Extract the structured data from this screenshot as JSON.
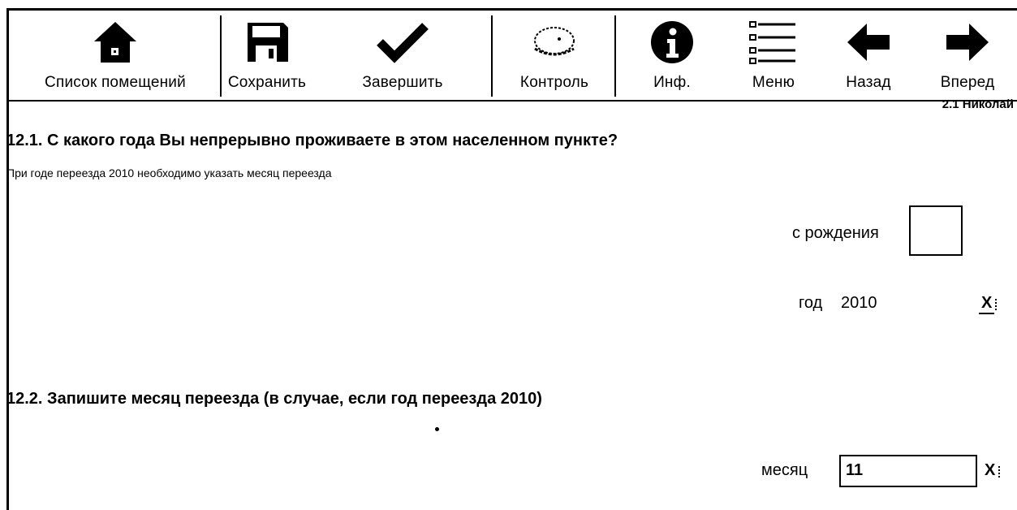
{
  "toolbar": {
    "items": [
      {
        "label": "Список помещений",
        "icon": "home-icon"
      },
      {
        "label": "Сохранить",
        "icon": "save-icon"
      },
      {
        "label": "Завершить",
        "icon": "checkmark-icon"
      },
      {
        "label": "Контроль",
        "icon": "control-icon"
      },
      {
        "label": "Инф.",
        "icon": "info-icon"
      },
      {
        "label": "Меню",
        "icon": "menu-list-icon"
      },
      {
        "label": "Назад",
        "icon": "arrow-left-icon"
      },
      {
        "label": "Вперед",
        "icon": "arrow-right-icon"
      }
    ]
  },
  "user_label": "2.1 Николай",
  "question1": {
    "title": "12.1. С какого года Вы непрерывно проживаете в этом населенном пункте?",
    "note": "При годе переезда 2010 необходимо указать месяц переезда",
    "birth_label": "с рождения",
    "year_label": "год",
    "year_value": "2010",
    "clear_label": "X"
  },
  "question2": {
    "title": "12.2. Запишите месяц переезда (в случае, если год переезда 2010)",
    "month_label": "месяц",
    "month_value": "11",
    "clear_label": "X"
  }
}
